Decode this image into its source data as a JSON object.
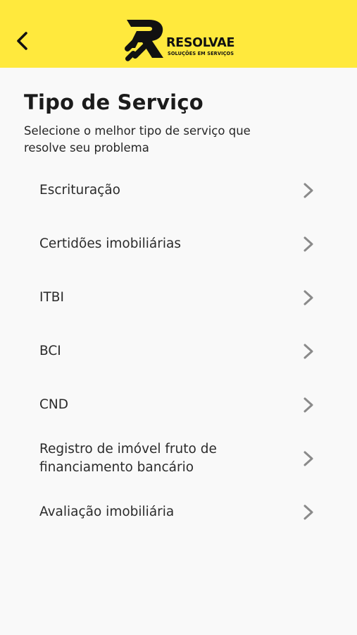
{
  "header": {
    "back_icon": "chevron-left-icon",
    "logo": {
      "word": "RESOLVAE",
      "tagline": "SOLUÇÕES EM SERVIÇOS",
      "brand_color": "#ffe93d"
    }
  },
  "page": {
    "title": "Tipo de Serviço",
    "subtitle": "Selecione o melhor tipo de serviço que resolve seu problema"
  },
  "services": [
    {
      "label": "Escrituração",
      "icon": "chevron-right-icon"
    },
    {
      "label": "Certidões imobiliárias",
      "icon": "chevron-right-icon"
    },
    {
      "label": "ITBI",
      "icon": "chevron-right-icon"
    },
    {
      "label": "BCI",
      "icon": "chevron-right-icon"
    },
    {
      "label": "CND",
      "icon": "chevron-right-icon"
    },
    {
      "label": "Registro de imóvel fruto de financiamento bancário",
      "icon": "chevron-right-icon"
    },
    {
      "label": "Avaliação imobiliária",
      "icon": "chevron-right-icon"
    }
  ]
}
